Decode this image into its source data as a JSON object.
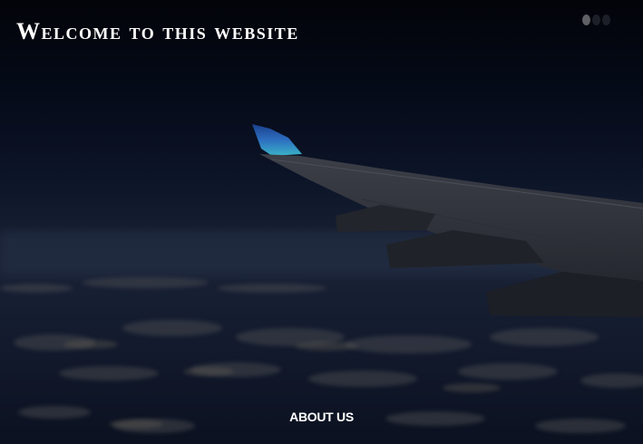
{
  "hero": {
    "title": "Welcome to this website",
    "about_link": "ABOUT US"
  },
  "slider": {
    "slide_count": 3,
    "active_index": 0
  },
  "icons": {
    "background": "airplane-wing-image"
  },
  "colors": {
    "sky_top": "#03050d",
    "sky_horizon": "#1a2236",
    "text": "#ffffff",
    "dot_active": "#5e6066",
    "dot_inactive": "#1c1f28"
  }
}
